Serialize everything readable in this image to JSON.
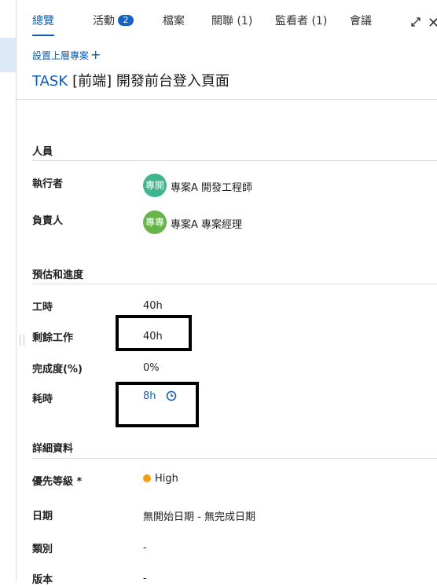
{
  "tabs": [
    {
      "label": "總覽",
      "active": true
    },
    {
      "label": "活動",
      "badge": "2"
    },
    {
      "label": "檔案"
    },
    {
      "label": "關聯 (1)"
    },
    {
      "label": "監看者 (1)"
    },
    {
      "label": "會議"
    }
  ],
  "header": {
    "parent_link": "設置上層專案",
    "type": "TASK",
    "title": "[前端] 開發前台登入頁面"
  },
  "people": {
    "section_title": "人員",
    "assignee": {
      "label": "執行者",
      "avatar": "專開",
      "name": "專案A 開發工程師",
      "avatar_color": "#3fb58f"
    },
    "owner": {
      "label": "負責人",
      "avatar": "專專",
      "name": "專案A 專案經理",
      "avatar_color": "#66b54a"
    }
  },
  "estimate": {
    "section_title": "預估和進度",
    "hours": {
      "label": "工時",
      "value": "40h"
    },
    "remaining": {
      "label": "剩餘工作",
      "value": "40h"
    },
    "progress": {
      "label": "完成度(%)",
      "value": "0%"
    },
    "spent": {
      "label": "耗時",
      "value": "8h"
    }
  },
  "details": {
    "section_title": "詳細資料",
    "priority": {
      "label": "優先等級 *",
      "value": "High",
      "color": "#f39c12"
    },
    "dates": {
      "label": "日期",
      "value": "無開始日期 - 無完成日期"
    },
    "category": {
      "label": "類別",
      "value": "-"
    },
    "version": {
      "label": "版本",
      "value": "-"
    }
  },
  "colors": {
    "accent": "#0b5cad",
    "badge": "#1763c5"
  }
}
